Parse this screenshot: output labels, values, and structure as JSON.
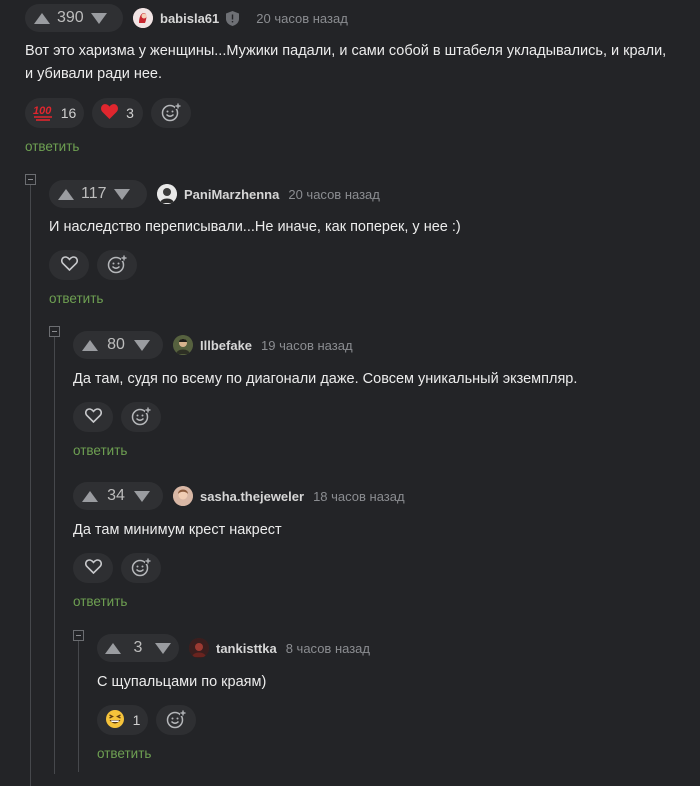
{
  "comments": [
    {
      "score": "390",
      "user": "babisla61",
      "time": "20 часов назад",
      "text": "Вот это харизма у женщины...Мужики падали, и сами собой в штабеля укладывались, и крали, и убивали ради нее.",
      "reactions": [
        {
          "icon": "hundred-points-emoji",
          "count": "16"
        },
        {
          "icon": "red-heart-emoji",
          "count": "3"
        }
      ],
      "reply_label": "ответить"
    },
    {
      "score": "117",
      "user": "PaniMarzhenna",
      "time": "20 часов назад",
      "text": "И наследство переписывали...Не иначе, как поперек, у нее :)",
      "reply_label": "ответить"
    },
    {
      "score": "80",
      "user": "Illbefake",
      "time": "19 часов назад",
      "text": "Да там, судя по всему по диагонали даже. Совсем уникальный экземпляр.",
      "reply_label": "ответить"
    },
    {
      "score": "34",
      "user": "sasha.thejeweler",
      "time": "18 часов назад",
      "text": "Да там минимум крест накрест",
      "reply_label": "ответить"
    },
    {
      "score": "3",
      "user": "tankisttka",
      "time": "8 часов назад",
      "text": "С щупальцами по краям)",
      "reactions": [
        {
          "icon": "grinning-squinting-face-emoji",
          "count": "1"
        }
      ],
      "reply_label": "ответить"
    }
  ],
  "colors": {
    "background": "#232427",
    "reply_link": "#6ea052",
    "heart": "#e0262e"
  }
}
